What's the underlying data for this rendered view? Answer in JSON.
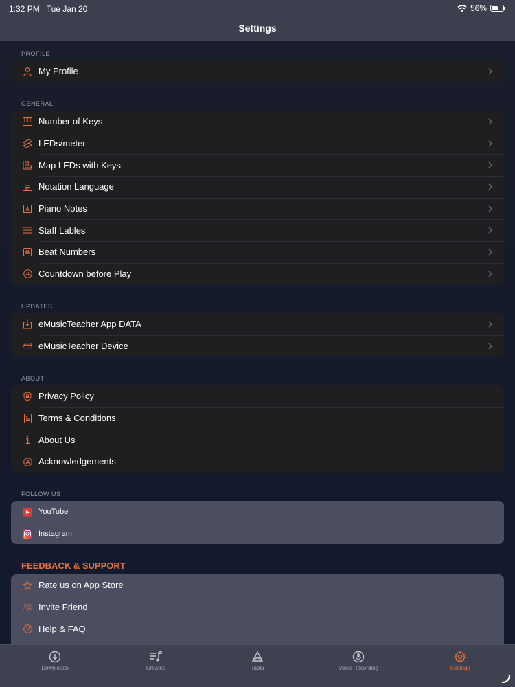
{
  "status": {
    "time": "1:32 PM",
    "date": "Tue Jan 20",
    "battery": "56%"
  },
  "nav": {
    "title": "Settings"
  },
  "colors": {
    "accent": "#e8703a",
    "background": "#151a2a",
    "group": "#1f1f22",
    "group_light": "#4b4e60"
  },
  "sections": {
    "profile": {
      "header": "PROFILE",
      "items": [
        {
          "label": "My Profile",
          "icon": "person-icon"
        }
      ]
    },
    "general": {
      "header": "GENERAL",
      "items": [
        {
          "label": "Number of Keys",
          "icon": "piano-keys-icon"
        },
        {
          "label": "LEDs/meter",
          "icon": "led-strip-icon"
        },
        {
          "label": "Map LEDs with Keys",
          "icon": "map-leds-icon"
        },
        {
          "label": "Notation Language",
          "icon": "notation-icon"
        },
        {
          "label": "Piano Notes",
          "icon": "note-letter-icon"
        },
        {
          "label": "Staff Lables",
          "icon": "staff-lines-icon"
        },
        {
          "label": "Beat Numbers",
          "icon": "hash-box-icon"
        },
        {
          "label": "Countdown before Play",
          "icon": "countdown-icon"
        }
      ]
    },
    "updates": {
      "header": "UPDATES",
      "items": [
        {
          "label": "eMusicTeacher App DATA",
          "icon": "download-box-icon"
        },
        {
          "label": "eMusicTeacher Device",
          "icon": "device-icon"
        }
      ]
    },
    "about": {
      "header": "ABOUT",
      "items": [
        {
          "label": "Privacy Policy",
          "icon": "shield-lock-icon"
        },
        {
          "label": "Terms & Conditions",
          "icon": "document-icon"
        },
        {
          "label": "About Us",
          "icon": "info-icon"
        },
        {
          "label": "Acknowledgements",
          "icon": "circle-a-icon"
        }
      ]
    },
    "follow": {
      "header": "FOLLOW US",
      "items": [
        {
          "label": "YouTube",
          "icon": "youtube-icon"
        },
        {
          "label": "Instagram",
          "icon": "instagram-icon"
        }
      ]
    },
    "feedback": {
      "header": "FEEDBACK & SUPPORT",
      "items": [
        {
          "label": "Rate us on App Store",
          "icon": "star-icon"
        },
        {
          "label": "Invite Friend",
          "icon": "people-icon"
        },
        {
          "label": "Help & FAQ",
          "icon": "question-icon"
        }
      ]
    }
  },
  "tabs": [
    {
      "label": "Downloads",
      "icon": "download-circle-icon",
      "active": false
    },
    {
      "label": "Created",
      "icon": "music-list-icon",
      "active": false
    },
    {
      "label": "Tabla",
      "icon": "tabla-icon",
      "active": false
    },
    {
      "label": "Voice Recording",
      "icon": "mic-icon",
      "active": false
    },
    {
      "label": "Settings",
      "icon": "gear-icon",
      "active": true
    }
  ]
}
